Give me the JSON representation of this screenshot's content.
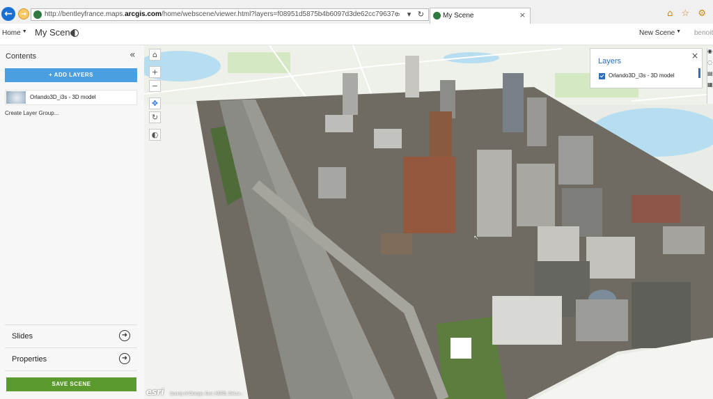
{
  "browser": {
    "back_icon": "←",
    "forward_icon": "→",
    "url_prefix": "http://bentleyfrance.maps.",
    "url_domain": "arcgis.com",
    "url_rest": "/home/webscene/viewer.html?layers=f08951d5875b4b6097d3de62cc79637e",
    "address_tools": "⌕ ▾ ↻",
    "tab_title": "My Scene",
    "tab_close": "×",
    "toolbar_icons": "⌂ ☆ ⚙"
  },
  "app": {
    "home_label": "Home",
    "scene_title": "My Scene",
    "new_scene_label": "New Scene",
    "user_name": "benoit"
  },
  "sidebar": {
    "title": "Contents",
    "collapse_icon": "«",
    "add_layers_label": "+ ADD LAYERS",
    "layer_name": "Orlando3D_i3s - 3D model",
    "create_group_label": "Create Layer Group...",
    "slides_label": "Slides",
    "properties_label": "Properties",
    "arrow_icon": "➜",
    "save_label": "SAVE SCENE"
  },
  "map": {
    "tools": [
      "⌂",
      "+",
      "−",
      "✥",
      "↻",
      "◐"
    ],
    "layers_panel_title": "Layers",
    "layers_close": "×",
    "layer_entry": "Orlando3D_i3s - 3D model",
    "right_tools": [
      "◉",
      "◌",
      "▤",
      "▦"
    ],
    "logo_text": "esri",
    "attribution": "County of Orange, Esri, HERE, DeLor...",
    "cursor_icon": "↖",
    "colors": {
      "ground": "#e9ece6",
      "water": "#b7def0",
      "park": "#d4e8c4",
      "highway": "#8b8b85",
      "accent": "#2b6fbf"
    }
  }
}
